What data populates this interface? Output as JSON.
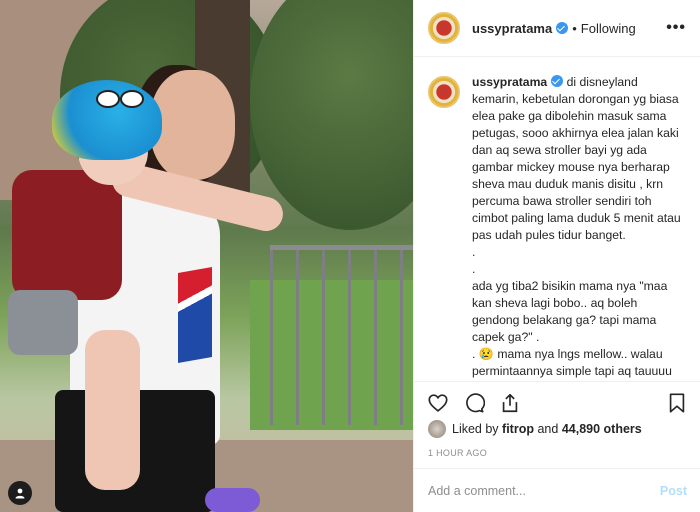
{
  "photo": {
    "tag_icon": "user-tag-icon"
  },
  "header": {
    "username": "ussypratama",
    "separator": "•",
    "follow_state": "Following",
    "more_icon": "more-options-icon",
    "more_label": "•••"
  },
  "caption": {
    "username": "ussypratama",
    "text": "di disneyland kemarin, kebetulan dorongan yg biasa elea pake ga dibolehin masuk sama petugas, sooo akhirnya elea jalan kaki dan aq sewa stroller bayi yg ada gambar mickey mouse nya berharap sheva mau duduk manis disitu , krn percuma bawa stroller sendiri toh cimbot paling lama duduk 5 menit atau pas udah pules tidur banget.\n.\n.\nada yg tiba2 bisikin mama nya \"maa kan sheva lagi bobo.. aq boleh gendong belakang ga? tapi mama capek ga?\" .\n. 😢 mama nya lngs mellow.. walau permintaannya simple tapi aq tauuuu banget gmn perasaan si incesss ini.."
  },
  "actions": {
    "like_icon": "heart-icon",
    "comment_icon": "comment-icon",
    "share_icon": "share-icon",
    "save_icon": "bookmark-icon"
  },
  "likes": {
    "prefix": "Liked by",
    "liker": "fitrop",
    "connector": "and",
    "others": "44,890 others"
  },
  "timestamp": "1 HOUR AGO",
  "comment": {
    "placeholder": "Add a comment...",
    "post_label": "Post"
  },
  "colors": {
    "verified": "#3897f0",
    "post_disabled": "#b2dffc",
    "meta_gray": "#8e8e8e"
  }
}
